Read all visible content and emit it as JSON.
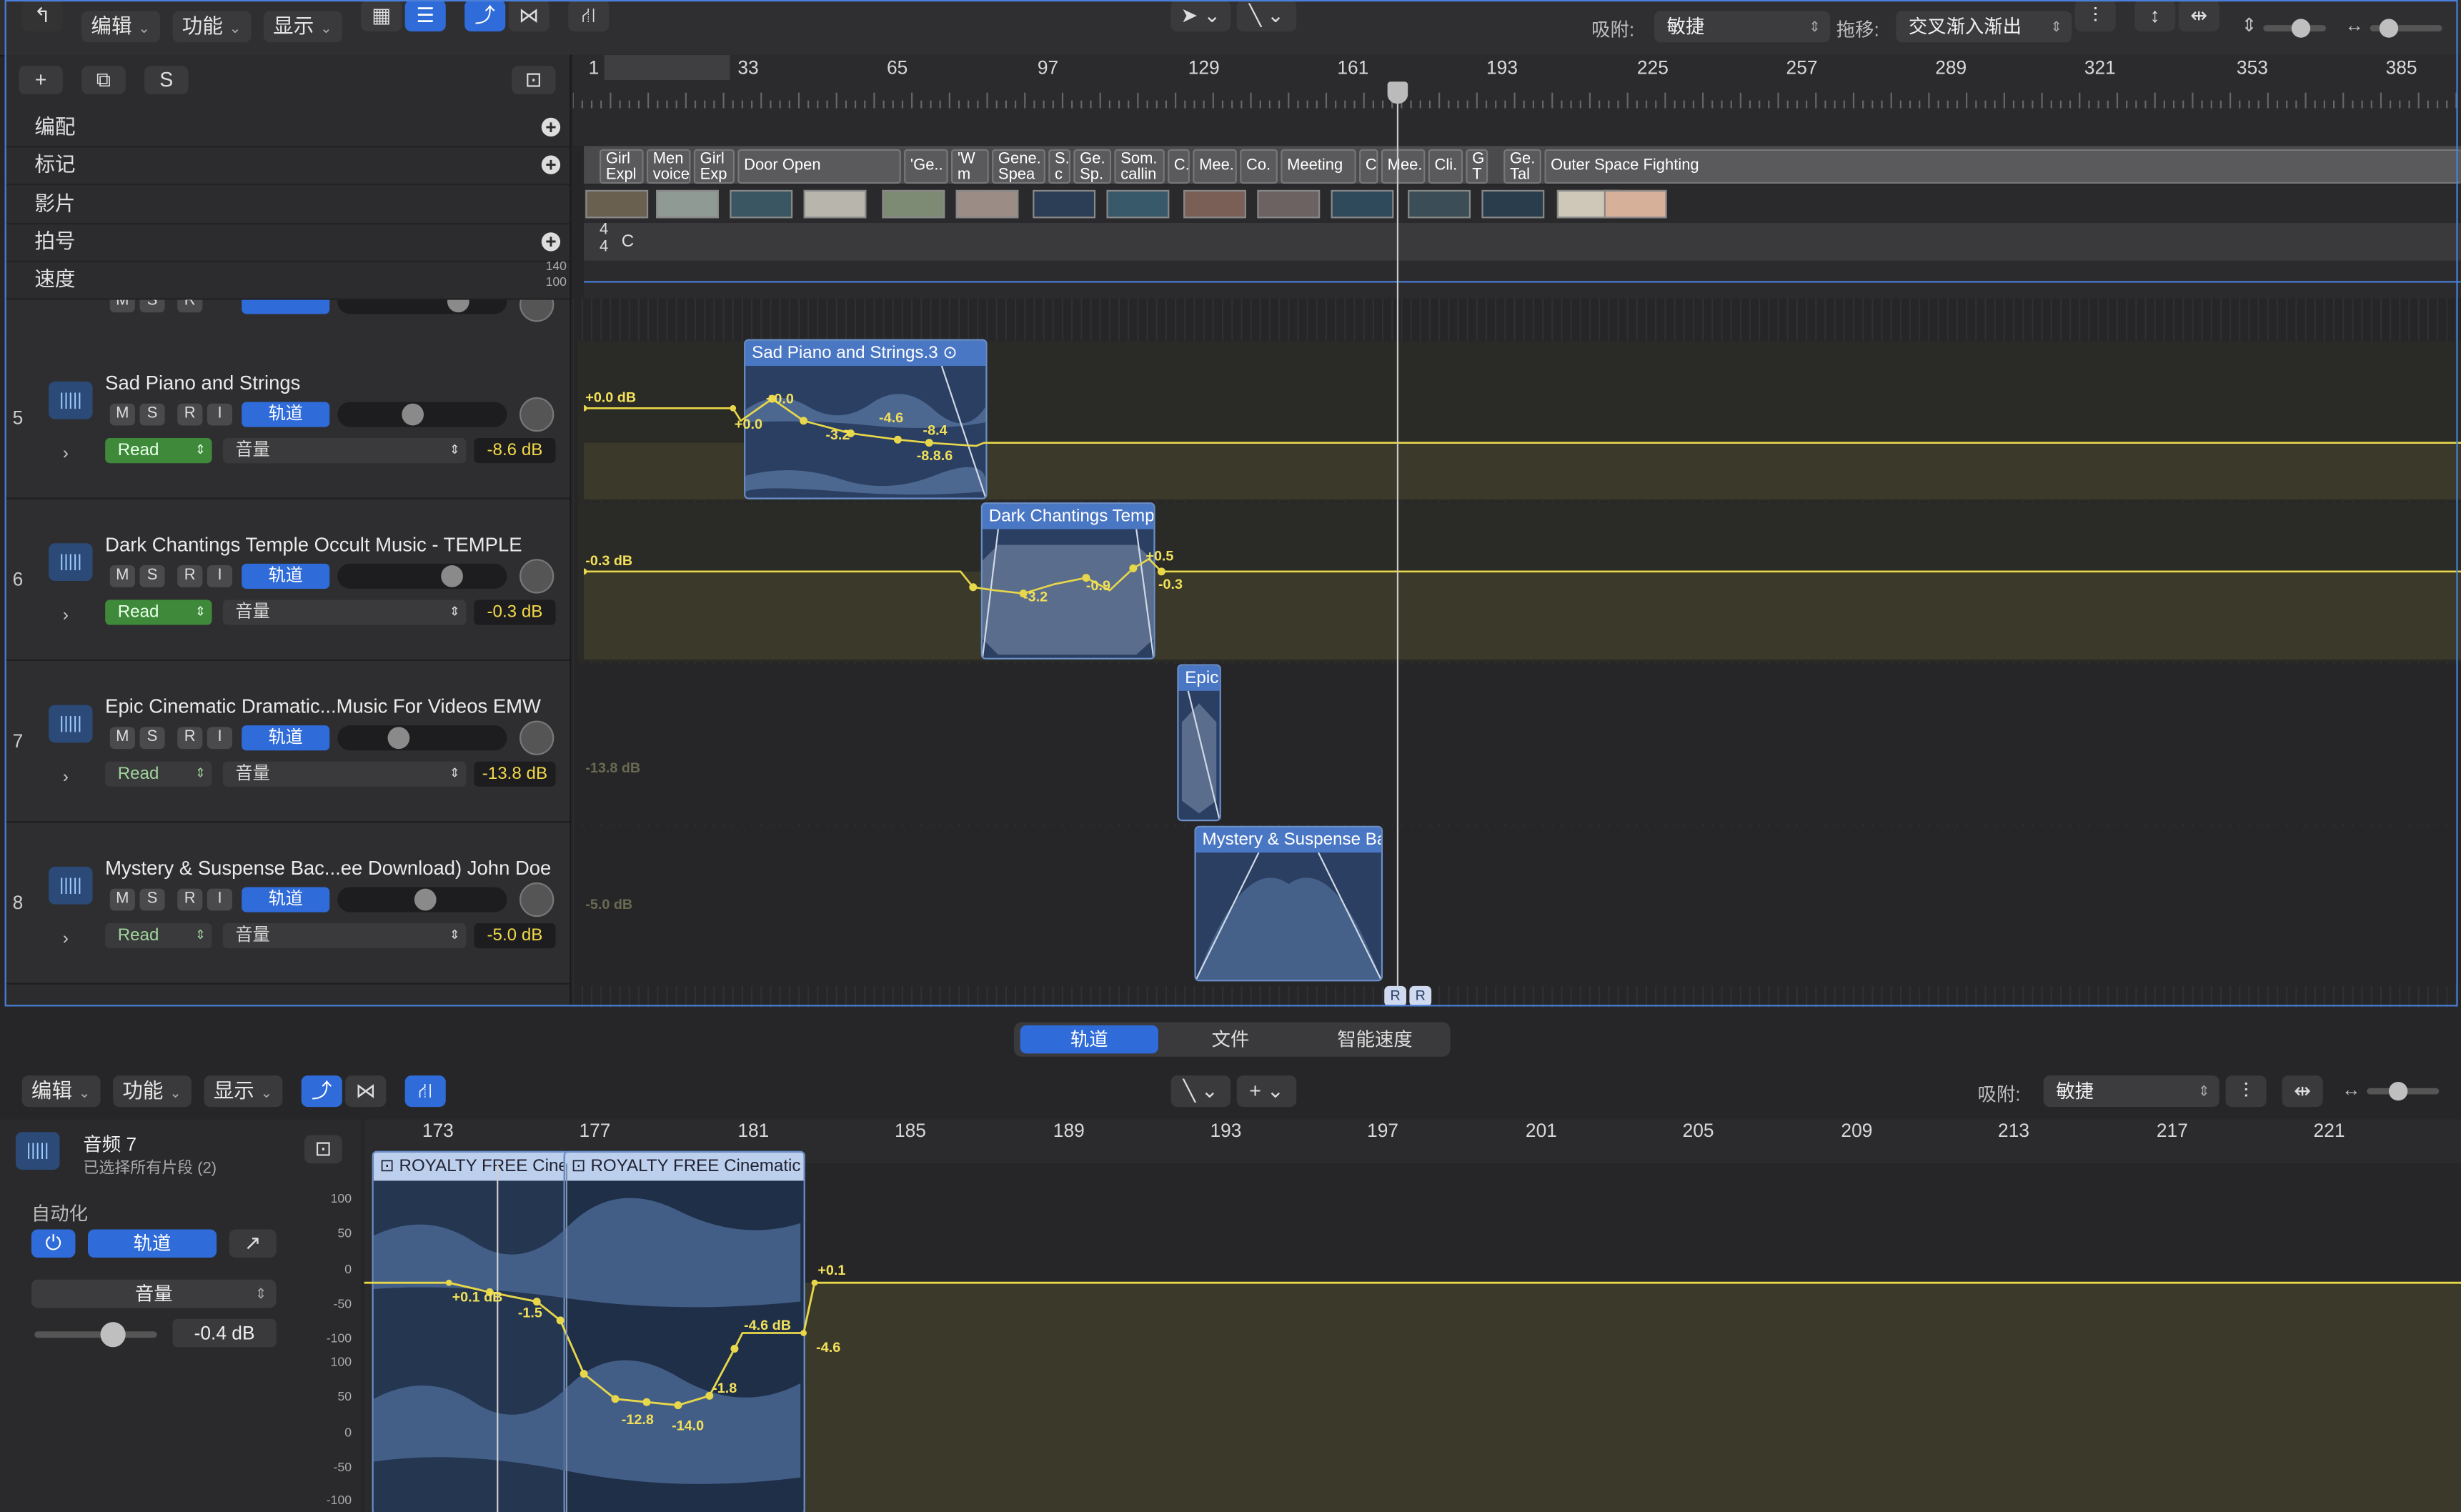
{
  "toolbar": {
    "menu_edit": "编辑",
    "menu_func": "功能",
    "menu_view": "显示",
    "snap_label": "吸附:",
    "snap_value": "敏捷",
    "drag_label": "拖移:",
    "drag_value": "交叉渐入渐出"
  },
  "header_buttons": {
    "solo": "S"
  },
  "global_tracks": [
    {
      "label": "编配",
      "has_add": true
    },
    {
      "label": "标记",
      "has_add": true
    },
    {
      "label": "影片",
      "has_add": false
    },
    {
      "label": "拍号",
      "has_add": true
    },
    {
      "label": "速度",
      "has_add": false,
      "tempo_hi": "140",
      "tempo_lo": "100"
    }
  ],
  "ruler": [
    "1",
    "33",
    "65",
    "97",
    "129",
    "161",
    "193",
    "225",
    "257",
    "289",
    "321",
    "353",
    "385"
  ],
  "markers": [
    "Girl Expl",
    "Men voice",
    "Girl Exp",
    "Door Open",
    "'Ge..",
    "'W m",
    "Gene. Spea",
    "S. c",
    "Ge. Sp.",
    "Som. callin",
    "C.",
    "Mee.",
    "Co.",
    "Meeting",
    "C",
    "Mee.",
    "Cli.",
    "G T",
    "Ge. Tal",
    "Outer Space Fighting"
  ],
  "signature": {
    "num": "4",
    "den": "4",
    "key": "C"
  },
  "tracks": [
    {
      "num": "5",
      "name": "Sad Piano and Strings",
      "mute": "M",
      "solo": "S",
      "rec": "R",
      "input": "I",
      "track_btn": "轨道",
      "mode": "Read",
      "param": "音量",
      "db": "-8.6 dB",
      "read_on": true,
      "vol": 0.44,
      "region": "Sad Piano and Strings.3",
      "auto_labels": [
        "+0.0 dB",
        "+0.0",
        "+0.0",
        "-3.2",
        "-4.6",
        "-8.4",
        "-8.8.6"
      ]
    },
    {
      "num": "6",
      "name": "Dark Chantings Temple Occult Music - TEMPLE",
      "mute": "M",
      "solo": "S",
      "rec": "R",
      "input": "I",
      "track_btn": "轨道",
      "mode": "Read",
      "param": "音量",
      "db": "-0.3 dB",
      "read_on": true,
      "vol": 0.7,
      "region": "Dark Chantings Templ",
      "auto_labels": [
        "-0.3 dB",
        "-3.2",
        "-0.9",
        "+0.5",
        "-0.3"
      ]
    },
    {
      "num": "7",
      "name": "Epic Cinematic Dramatic...Music For Videos  EMW",
      "mute": "M",
      "solo": "S",
      "rec": "R",
      "input": "I",
      "track_btn": "轨道",
      "mode": "Read",
      "param": "音量",
      "db": "-13.8 dB",
      "read_on": false,
      "vol": 0.34,
      "region": "Epic",
      "auto_labels": [
        "-13.8 dB"
      ]
    },
    {
      "num": "8",
      "name": "Mystery & Suspense Bac...ee Download)  John Doe",
      "mute": "M",
      "solo": "S",
      "rec": "R",
      "input": "I",
      "track_btn": "轨道",
      "mode": "Read",
      "param": "音量",
      "db": "-5.0 dB",
      "read_on": false,
      "vol": 0.52,
      "region": "Mystery & Suspense Ba",
      "auto_labels": [
        "-5.0 dB"
      ]
    }
  ],
  "playhead_badges": [
    "R",
    "R"
  ],
  "bottom": {
    "tabs": [
      "轨道",
      "文件",
      "智能速度"
    ],
    "menu_edit": "编辑",
    "menu_func": "功能",
    "menu_view": "显示",
    "snap_label": "吸附:",
    "snap_value": "敏捷",
    "track_title": "音频 7",
    "track_sub": "已选择所有片段 (2)",
    "auto_label": "自动化",
    "track_btn": "轨道",
    "param": "音量",
    "gain": "-0.4 dB",
    "ruler": [
      "173",
      "177",
      "181",
      "185",
      "189",
      "193",
      "197",
      "201",
      "205",
      "209",
      "213",
      "217",
      "221"
    ],
    "regions": [
      "ROYALTY FREE Cine",
      "ROYALTY FREE Cinematic"
    ],
    "yaxis": [
      "100",
      "50",
      "0",
      "-50",
      "-100",
      "100",
      "50",
      "0",
      "-50",
      "-100"
    ],
    "auto_labels": [
      "+0.1 dB",
      "-1.5",
      "-12.8",
      "-14.0",
      "-1.8",
      "-4.6 dB",
      "+0.1",
      "-4.6"
    ]
  }
}
